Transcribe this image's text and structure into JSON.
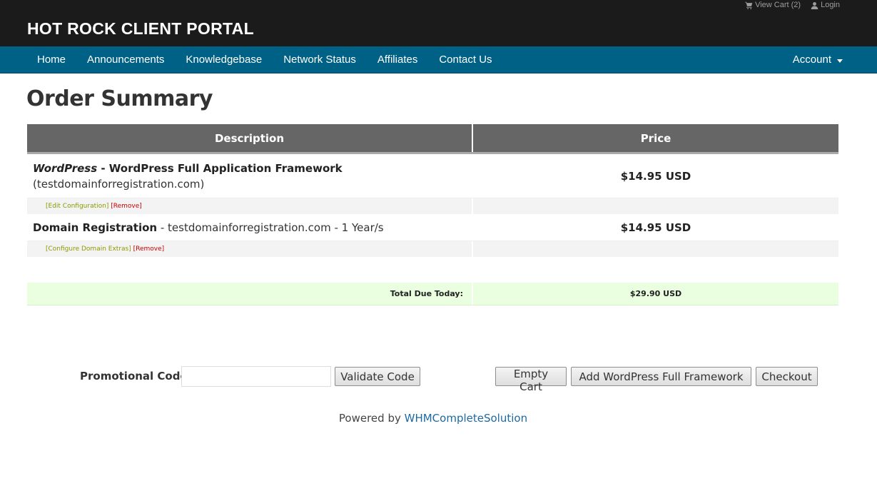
{
  "header": {
    "brand": "HOT ROCK CLIENT PORTAL",
    "view_cart": "View Cart (2)",
    "login": "Login"
  },
  "nav": {
    "items": [
      "Home",
      "Announcements",
      "Knowledgebase",
      "Network Status",
      "Affiliates",
      "Contact Us"
    ],
    "account": "Account"
  },
  "page": {
    "title": "Order Summary"
  },
  "table": {
    "headers": {
      "description": "Description",
      "price": "Price"
    },
    "items": [
      {
        "product": "WordPress",
        "separator": " - ",
        "name": "WordPress Full Application Framework",
        "domain": "(testdomainforregistration.com)",
        "price": "$14.95 USD",
        "action_edit": "[Edit Configuration]",
        "action_remove": "[Remove]"
      },
      {
        "name": "Domain Registration",
        "detail": " - testdomainforregistration.com - 1 Year/s",
        "price": "$14.95 USD",
        "action_edit": "[Configure Domain Extras]",
        "action_remove": "[Remove]"
      }
    ],
    "total_label": "Total Due Today:",
    "total_value": "$29.90 USD"
  },
  "form": {
    "promo_label": "Promotional Code",
    "promo_value": "",
    "validate_button": "Validate Code",
    "empty_cart_button": "Empty Cart",
    "add_button": "Add WordPress Full Framework",
    "checkout_button": "Checkout"
  },
  "footer": {
    "powered_prefix": "Powered by ",
    "powered_link": "WHMCompleteSolution"
  },
  "colors": {
    "header_bg": "#1b1b1b",
    "nav_bg": "#006186",
    "table_header_bg": "#666666",
    "total_row_bg": "#eaffe0",
    "link_blue": "#1d6aa3"
  }
}
